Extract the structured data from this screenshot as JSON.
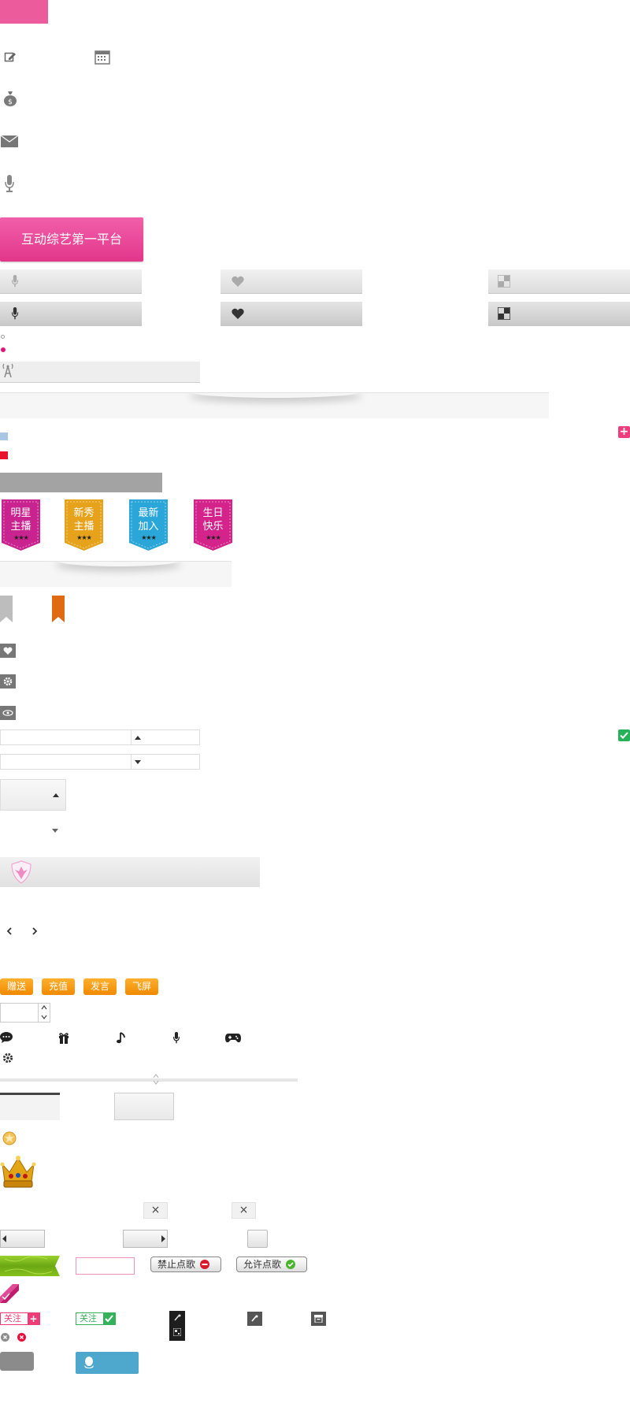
{
  "colors": {
    "pink": "#ee4aa0",
    "pink_dark": "#e23d86",
    "gray_btn": "#e6e6e6",
    "orange": "#f59a0c",
    "green_check": "#3bb44a",
    "red_x": "#e8103a",
    "qq_blue": "#4ea7cd"
  },
  "top_icons": {
    "edit": "edit-icon",
    "calendar": "calendar-icon",
    "money_bag": "money-bag-icon",
    "mail": "mail-icon",
    "microphone": "microphone-icon"
  },
  "banner": {
    "label": "互动综艺第一平台"
  },
  "ribbons": [
    {
      "line1": "明星",
      "line2": "主播",
      "stars": "★★★",
      "color": "#c8238f"
    },
    {
      "line1": "新秀",
      "line2": "主播",
      "stars": "★★★",
      "color": "#e6a21b"
    },
    {
      "line1": "最新",
      "line2": "加入",
      "stars": "★★★",
      "color": "#2aa6d8"
    },
    {
      "line1": "生日",
      "line2": "快乐",
      "stars": "★★★",
      "color": "#d4238a"
    }
  ],
  "action_buttons": [
    {
      "label": "赠送"
    },
    {
      "label": "充值"
    },
    {
      "label": "发言"
    },
    {
      "label": "飞屏"
    }
  ],
  "toolbar_icons": [
    "chat-icon",
    "gift-icon",
    "music-icon",
    "microphone-icon",
    "gamepad-icon"
  ],
  "song_buttons": {
    "forbid": "禁止点歌",
    "allow": "允许点歌"
  },
  "follow_buttons": {
    "follow": "关注",
    "followed": "关注"
  },
  "close_glyph": "×"
}
